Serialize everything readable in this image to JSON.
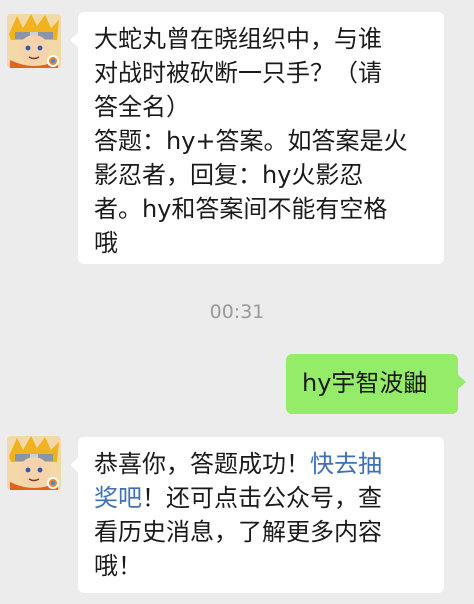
{
  "messages": [
    {
      "sender": "official-account",
      "lines": [
        "大蛇丸曾在晓组织中，与谁",
        "对战时被砍断一只手？（请",
        "答全名）",
        "答题：hy+答案。如答案是火",
        "影忍者，回复：hy火影忍",
        "者。hy和答案间不能有空格",
        "哦"
      ]
    },
    {
      "sender": "me",
      "text": "hy宇智波鼬"
    },
    {
      "sender": "official-account",
      "line1_pre": "恭喜你，答题成功！",
      "line1_link": "快去抽",
      "line2_link": "奖吧",
      "line2_post": "！还可点击公众号，查",
      "line3": "看历史消息，了解更多内容",
      "line4": "哦！"
    }
  ],
  "timestamp": "00:31",
  "avatar_icon": "naruto-avatar-icon",
  "colors": {
    "background": "#ececec",
    "bubble_in": "#ffffff",
    "bubble_out": "#95ec69",
    "link": "#3f6fb5",
    "timestamp": "#9a9a9a"
  }
}
